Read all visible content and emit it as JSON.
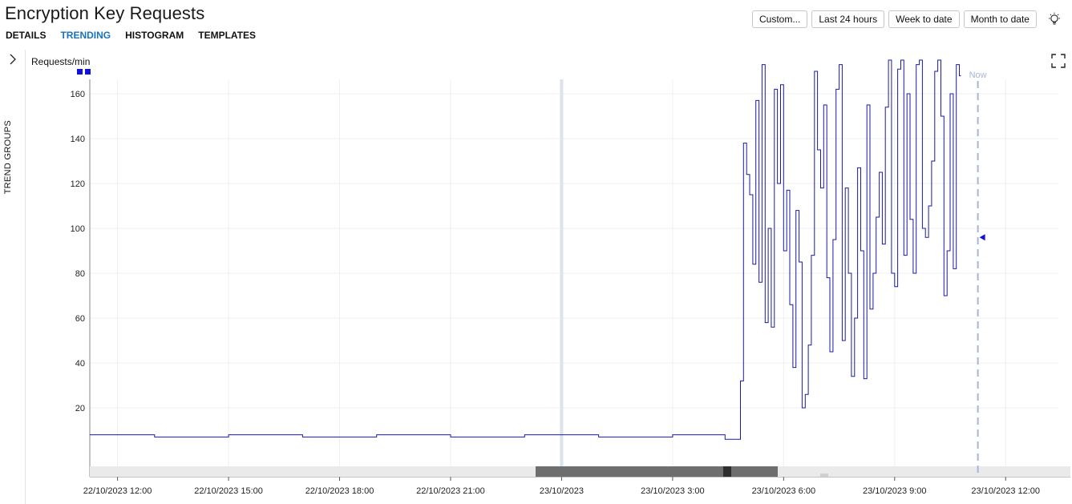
{
  "header": {
    "title": "Encryption Key Requests"
  },
  "tabs": [
    {
      "label": "DETAILS",
      "active": false
    },
    {
      "label": "TRENDING",
      "active": true
    },
    {
      "label": "HISTOGRAM",
      "active": false
    },
    {
      "label": "TEMPLATES",
      "active": false
    }
  ],
  "range_buttons": [
    "Custom...",
    "Last 24 hours",
    "Week to date",
    "Month to date"
  ],
  "icons": {
    "theme": "lightbulb-icon",
    "expand": "fullscreen-icon",
    "sidebar_toggle": "chevron-right-icon"
  },
  "sidebar": {
    "label": "TREND GROUPS"
  },
  "colors": {
    "series": "#1a1aa8",
    "accent": "#1a73b8",
    "now_line": "#aab4d8",
    "scroll_thumb": "#6e6e6e"
  },
  "chart_data": {
    "type": "line",
    "ylabel": "Requests/min",
    "now_label": "Now",
    "yticks": [
      20,
      40,
      60,
      80,
      100,
      120,
      140,
      160
    ],
    "xticks": [
      "22/10/2023 12:00",
      "22/10/2023 15:00",
      "22/10/2023 18:00",
      "22/10/2023 21:00",
      "23/10/2023",
      "23/10/2023 3:00",
      "23/10/2023 6:00",
      "23/10/2023 9:00",
      "23/10/2023 12:00"
    ],
    "xrange": [
      "22/10/2023 11:15",
      "23/10/2023 13:45"
    ],
    "ylim": [
      0,
      175
    ],
    "now_time": "23/10/2023 11:15",
    "now_marker_value": 96,
    "series": [
      {
        "step": true,
        "x": [
          "22/10/2023 11:15",
          "22/10/2023 13:00",
          "22/10/2023 15:00",
          "22/10/2023 17:00",
          "22/10/2023 19:00",
          "22/10/2023 21:00",
          "22/10/2023 23:00",
          "23/10/2023 01:00",
          "23/10/2023 03:00",
          "23/10/2023 04:25",
          "23/10/2023 04:50",
          "23/10/2023 04:55",
          "23/10/2023 05:00",
          "23/10/2023 05:05",
          "23/10/2023 05:10",
          "23/10/2023 05:15",
          "23/10/2023 05:20",
          "23/10/2023 05:25",
          "23/10/2023 05:30",
          "23/10/2023 05:35",
          "23/10/2023 05:40",
          "23/10/2023 05:45",
          "23/10/2023 05:50",
          "23/10/2023 05:55",
          "23/10/2023 06:00",
          "23/10/2023 06:05",
          "23/10/2023 06:10",
          "23/10/2023 06:15",
          "23/10/2023 06:20",
          "23/10/2023 06:25",
          "23/10/2023 06:30",
          "23/10/2023 06:35",
          "23/10/2023 06:40",
          "23/10/2023 06:45",
          "23/10/2023 06:50",
          "23/10/2023 06:55",
          "23/10/2023 07:00",
          "23/10/2023 07:05",
          "23/10/2023 07:10",
          "23/10/2023 07:15",
          "23/10/2023 07:20",
          "23/10/2023 07:25",
          "23/10/2023 07:30",
          "23/10/2023 07:35",
          "23/10/2023 07:40",
          "23/10/2023 07:45",
          "23/10/2023 07:50",
          "23/10/2023 07:55",
          "23/10/2023 08:00",
          "23/10/2023 08:05",
          "23/10/2023 08:10",
          "23/10/2023 08:15",
          "23/10/2023 08:20",
          "23/10/2023 08:25",
          "23/10/2023 08:30",
          "23/10/2023 08:35",
          "23/10/2023 08:40",
          "23/10/2023 08:45",
          "23/10/2023 08:50",
          "23/10/2023 08:55",
          "23/10/2023 09:00",
          "23/10/2023 09:05",
          "23/10/2023 09:10",
          "23/10/2023 09:15",
          "23/10/2023 09:20",
          "23/10/2023 09:25",
          "23/10/2023 09:30",
          "23/10/2023 09:35",
          "23/10/2023 09:40",
          "23/10/2023 09:45",
          "23/10/2023 09:50",
          "23/10/2023 09:55",
          "23/10/2023 10:00",
          "23/10/2023 10:05",
          "23/10/2023 10:10",
          "23/10/2023 10:15",
          "23/10/2023 10:20",
          "23/10/2023 10:25",
          "23/10/2023 10:30",
          "23/10/2023 10:35",
          "23/10/2023 10:40",
          "23/10/2023 10:45"
        ],
        "y": [
          8,
          7,
          8,
          7,
          8,
          7,
          8,
          7,
          8,
          6,
          32,
          138,
          124,
          115,
          84,
          157,
          76,
          173,
          58,
          100,
          56,
          162,
          120,
          164,
          90,
          117,
          66,
          38,
          108,
          85,
          20,
          26,
          48,
          88,
          170,
          135,
          118,
          155,
          78,
          45,
          95,
          162,
          173,
          50,
          118,
          80,
          34,
          60,
          127,
          90,
          33,
          155,
          64,
          80,
          105,
          125,
          93,
          154,
          175,
          80,
          74,
          171,
          175,
          88,
          160,
          104,
          80,
          173,
          175,
          100,
          96,
          110,
          130,
          170,
          175,
          150,
          70,
          90,
          160,
          82,
          173,
          168
        ]
      }
    ]
  }
}
